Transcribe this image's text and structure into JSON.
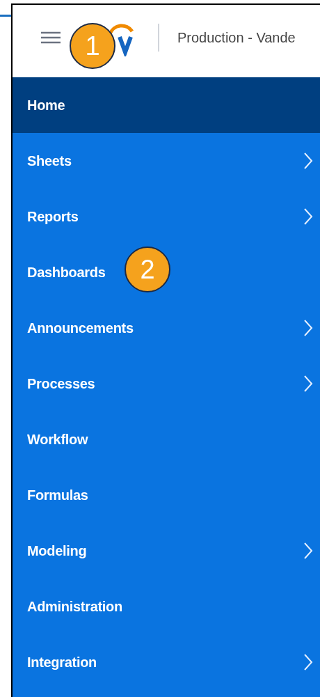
{
  "header": {
    "title": "Production - Vande"
  },
  "nav_items": [
    {
      "label": "Home",
      "selected": true,
      "has_submenu": false
    },
    {
      "label": "Sheets",
      "selected": false,
      "has_submenu": true
    },
    {
      "label": "Reports",
      "selected": false,
      "has_submenu": true
    },
    {
      "label": "Dashboards",
      "selected": false,
      "has_submenu": false
    },
    {
      "label": "Announcements",
      "selected": false,
      "has_submenu": true
    },
    {
      "label": "Processes",
      "selected": false,
      "has_submenu": true
    },
    {
      "label": "Workflow",
      "selected": false,
      "has_submenu": false
    },
    {
      "label": "Formulas",
      "selected": false,
      "has_submenu": false
    },
    {
      "label": "Modeling",
      "selected": false,
      "has_submenu": true
    },
    {
      "label": "Administration",
      "selected": false,
      "has_submenu": false
    },
    {
      "label": "Integration",
      "selected": false,
      "has_submenu": true
    }
  ],
  "callouts": [
    {
      "number": "1"
    },
    {
      "number": "2"
    }
  ]
}
